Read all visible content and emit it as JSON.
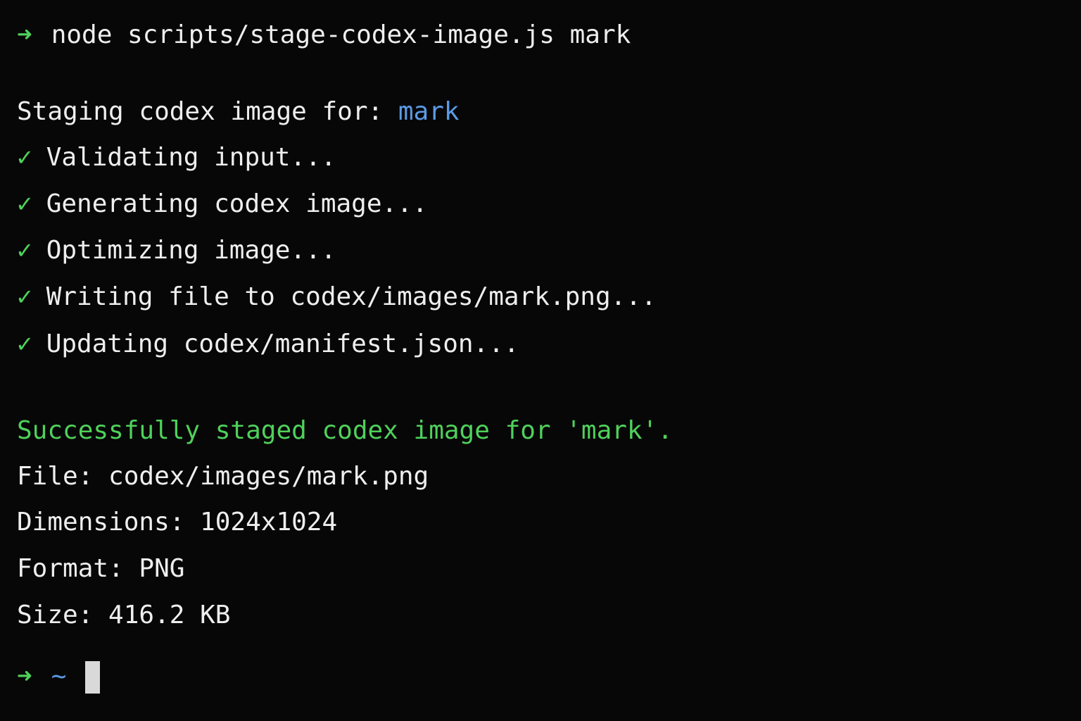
{
  "prompt": {
    "arrow": "➜",
    "command": "node scripts/stage-codex-image.js mark"
  },
  "header": {
    "label": "Staging codex image for: ",
    "target": "mark"
  },
  "steps": [
    {
      "icon": "✓",
      "text": "Validating input..."
    },
    {
      "icon": "✓",
      "text": "Generating codex image..."
    },
    {
      "icon": "✓",
      "text": "Optimizing image..."
    },
    {
      "icon": "✓",
      "text": "Writing file to codex/images/mark.png..."
    },
    {
      "icon": "✓",
      "text": "Updating codex/manifest.json..."
    }
  ],
  "result": {
    "success": "Successfully staged codex image for 'mark'.",
    "file": "File: codex/images/mark.png",
    "dimensions": "Dimensions: 1024x1024",
    "format": "Format: PNG",
    "size": "Size: 416.2 KB"
  },
  "final_prompt": {
    "arrow": "➜",
    "cwd": "~"
  },
  "colors": {
    "background": "#070707",
    "text": "#eeeeee",
    "green": "#4fd15b",
    "blue": "#5b9be6",
    "cursor": "#d9d9d9"
  }
}
